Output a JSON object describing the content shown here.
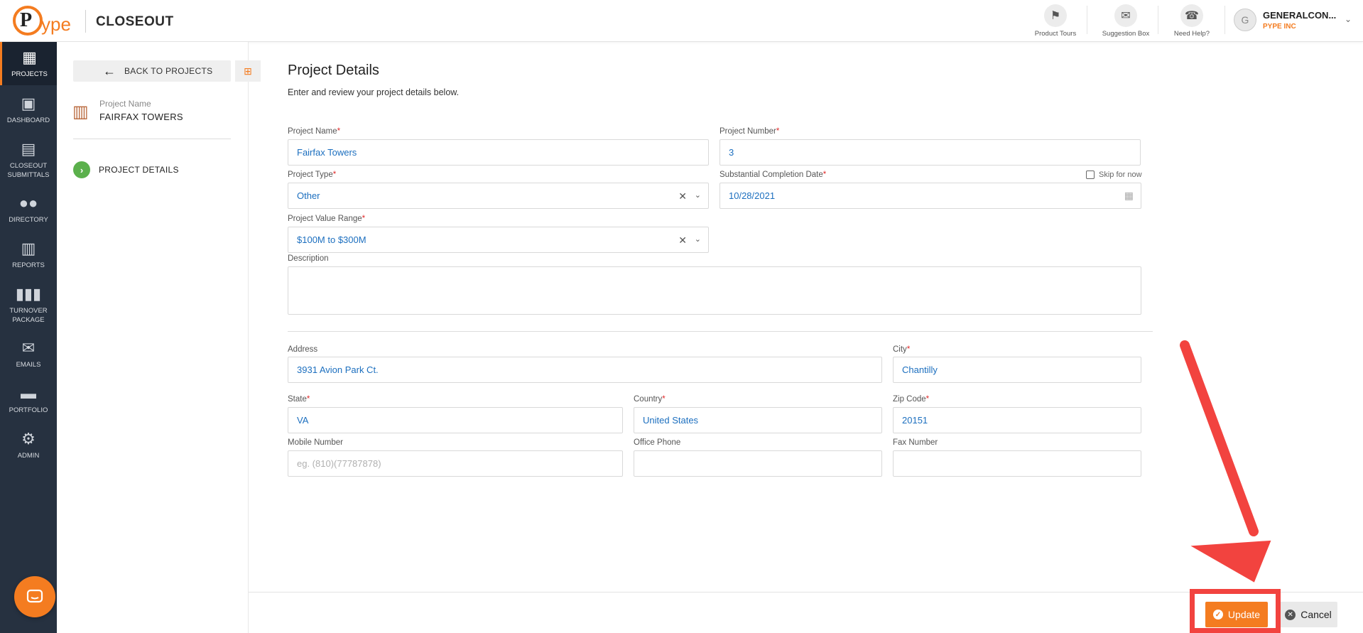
{
  "header": {
    "app_title": "CLOSEOUT",
    "tools": [
      {
        "label": "Product Tours",
        "icon": "signpost-icon"
      },
      {
        "label": "Suggestion Box",
        "icon": "suggestion-box-icon"
      },
      {
        "label": "Need Help?",
        "icon": "phone-help-icon"
      }
    ],
    "user": {
      "initial": "G",
      "name": "GENERALCON...",
      "org": "PYPE INC"
    }
  },
  "sidebar": {
    "items": [
      {
        "label": "PROJECTS",
        "active": true
      },
      {
        "label": "DASHBOARD"
      },
      {
        "label": "CLOSEOUT SUBMITTALS"
      },
      {
        "label": "DIRECTORY"
      },
      {
        "label": "REPORTS"
      },
      {
        "label": "TURNOVER PACKAGE"
      },
      {
        "label": "EMAILS"
      },
      {
        "label": "PORTFOLIO"
      },
      {
        "label": "ADMIN"
      }
    ]
  },
  "left_panel": {
    "back_label": "BACK TO PROJECTS",
    "project_label": "Project Name",
    "project_name": "FAIRFAX TOWERS",
    "step_label": "PROJECT DETAILS"
  },
  "main": {
    "title": "Project Details",
    "subtitle": "Enter and review your project details below.",
    "fields": {
      "project_name": {
        "label": "Project Name",
        "value": "Fairfax Towers"
      },
      "project_number": {
        "label": "Project Number",
        "value": "3"
      },
      "project_type": {
        "label": "Project Type",
        "value": "Other"
      },
      "completion_date": {
        "label": "Substantial Completion Date",
        "value": "10/28/2021"
      },
      "skip_label": "Skip for now",
      "value_range": {
        "label": "Project Value Range",
        "value": "$100M to $300M"
      },
      "description": {
        "label": "Description",
        "value": ""
      },
      "address": {
        "label": "Address",
        "value": "3931 Avion Park Ct."
      },
      "city": {
        "label": "City",
        "value": "Chantilly"
      },
      "state": {
        "label": "State",
        "value": "VA"
      },
      "country": {
        "label": "Country",
        "value": "United States"
      },
      "zip": {
        "label": "Zip Code",
        "value": "20151"
      },
      "mobile": {
        "label": "Mobile Number",
        "placeholder": "eg. (810)(77787878)"
      },
      "office_phone": {
        "label": "Office Phone",
        "value": ""
      },
      "fax": {
        "label": "Fax Number",
        "value": ""
      }
    },
    "required_mark": "*"
  },
  "footer": {
    "update_label": "Update",
    "cancel_label": "Cancel"
  },
  "colors": {
    "brand_orange": "#f47c20",
    "sidebar_bg": "#263140",
    "field_text": "#1c6fbf",
    "annotation_red": "#f2433f",
    "step_green": "#5bb04c"
  }
}
